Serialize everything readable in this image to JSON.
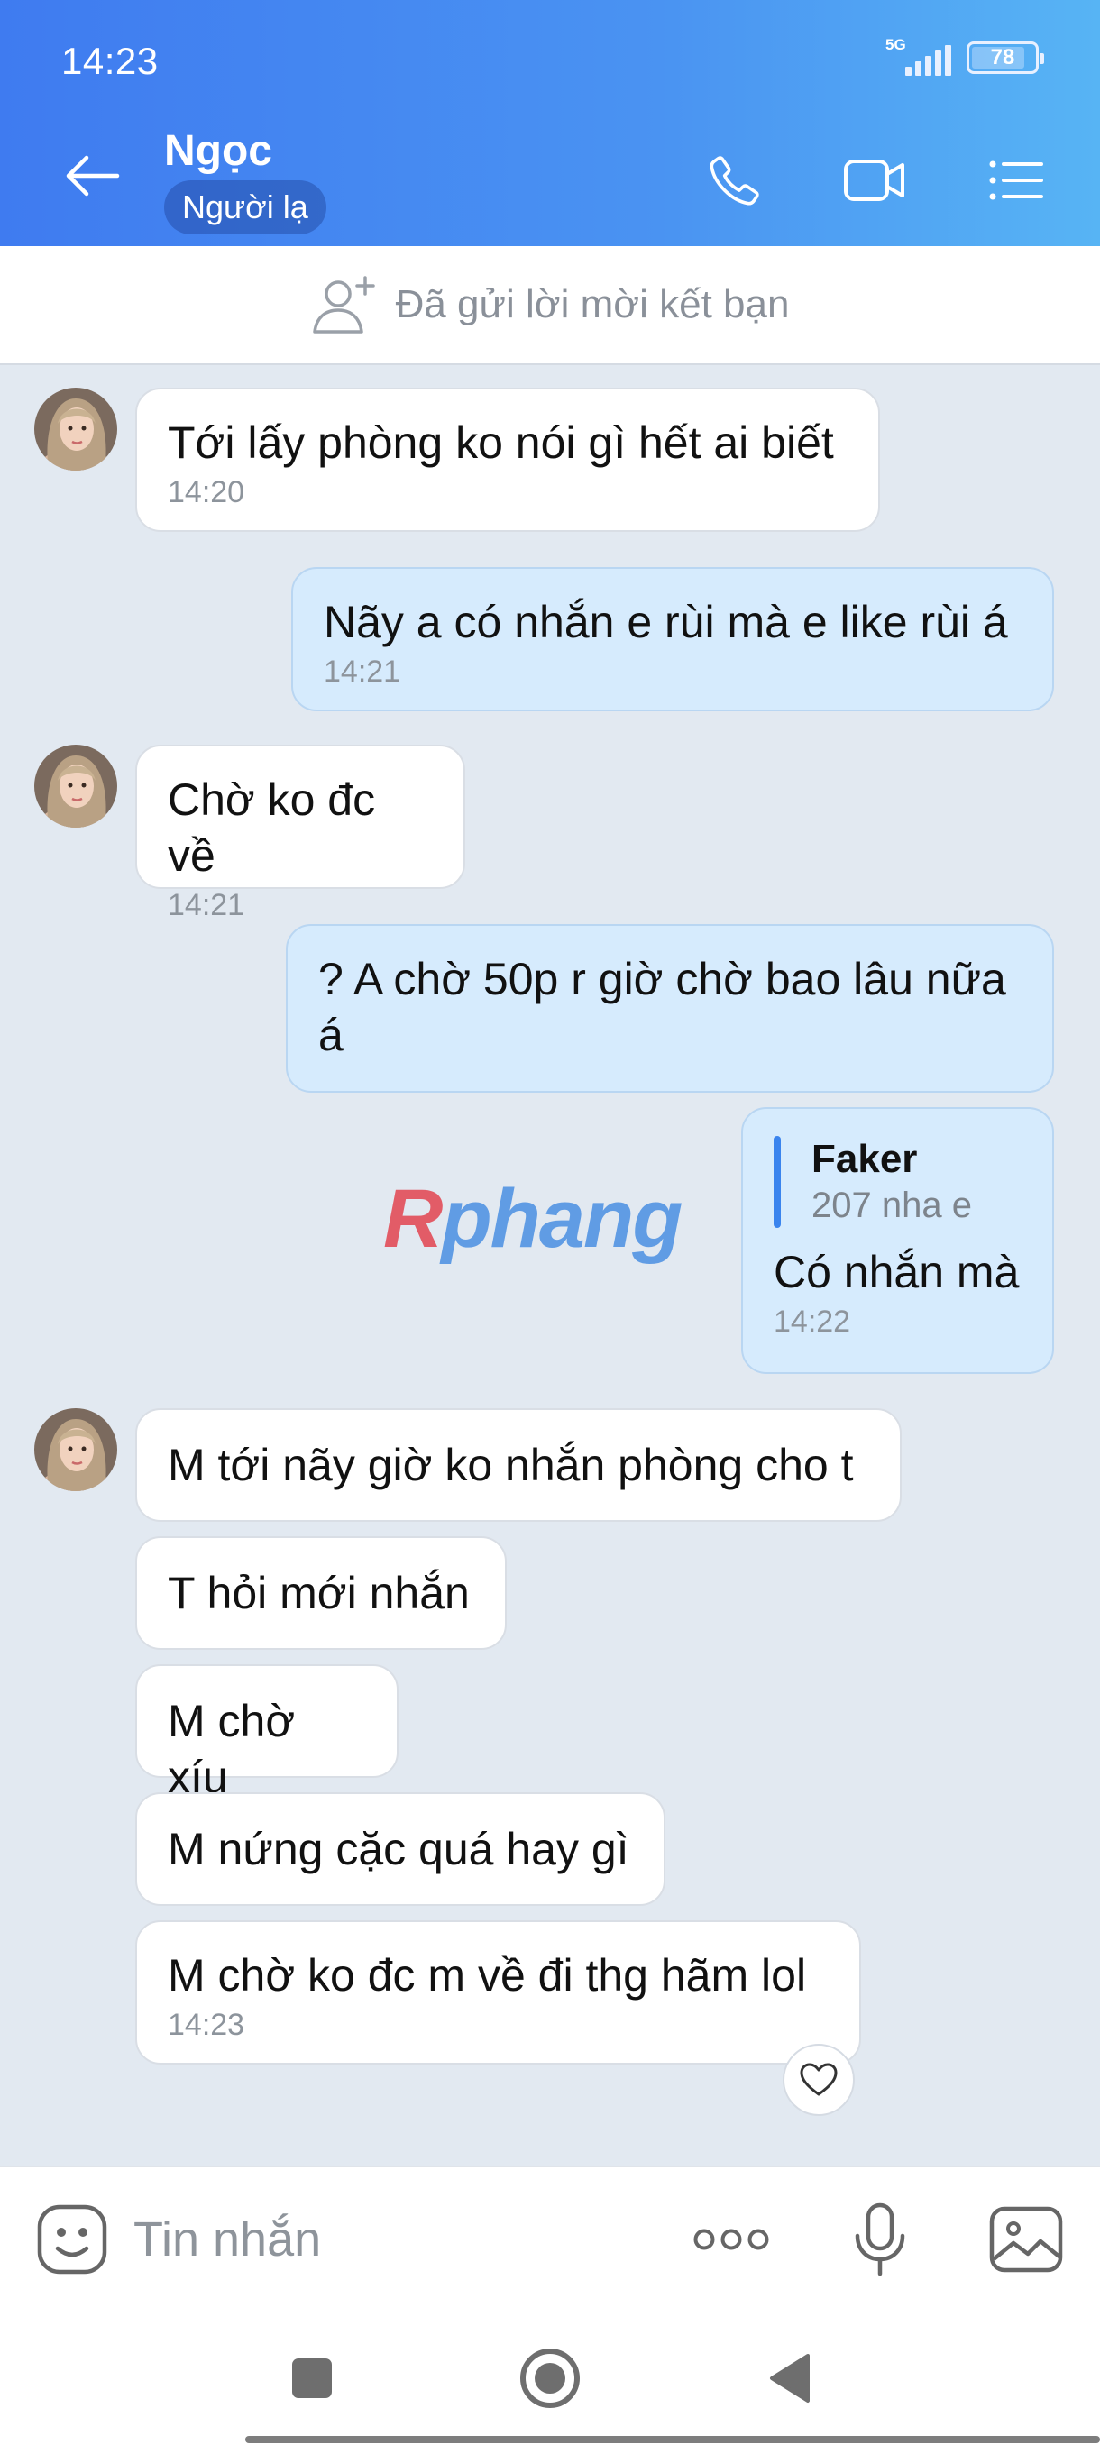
{
  "status_bar": {
    "time": "14:23",
    "network": "5G",
    "battery": "78"
  },
  "header": {
    "contact_name": "Ngọc",
    "badge": "Người lạ"
  },
  "friend_request": {
    "text": "Đã gửi lời mời kết bạn"
  },
  "messages": [
    {
      "dir": "in",
      "text": "Tới lấy phòng ko nói gì hết ai biết",
      "time": "14:20"
    },
    {
      "dir": "out",
      "text": "Nãy a có nhắn e rùi mà e like rùi á",
      "time": "14:21"
    },
    {
      "dir": "in",
      "text": "Chờ ko đc về",
      "time": "14:21"
    },
    {
      "dir": "out",
      "text": "? A chờ 50p r giờ chờ bao lâu nữa á"
    },
    {
      "dir": "out",
      "quote_name": "Faker",
      "quote_text": "207 nha e",
      "text": "Có nhắn mà",
      "time": "14:22"
    },
    {
      "dir": "in",
      "text": "M tới nãy giờ ko nhắn phòng cho t"
    },
    {
      "dir": "in",
      "text": "T hỏi mới nhắn"
    },
    {
      "dir": "in",
      "text": "M chờ xíu"
    },
    {
      "dir": "in",
      "text": "M nứng cặc quá hay gì"
    },
    {
      "dir": "in",
      "text": "M chờ ko đc m về đi thg hãm lol",
      "time": "14:23"
    }
  ],
  "watermark": {
    "first": "R",
    "rest": "phang"
  },
  "input": {
    "placeholder": "Tin nhắn"
  },
  "icons": {
    "back": "arrow-left-icon",
    "call": "phone-icon",
    "video": "video-camera-icon",
    "menu": "list-menu-icon",
    "add_friend": "add-person-icon",
    "emoji": "emoji-icon",
    "more": "more-dots-icon",
    "mic": "microphone-icon",
    "image": "image-icon",
    "heart": "heart-icon"
  },
  "colors": {
    "header_start": "#3f7bf0",
    "header_end": "#57b4f4",
    "out_bubble": "#d6ebfd",
    "in_bubble": "#ffffff",
    "chat_bg": "#e2e9f1"
  }
}
